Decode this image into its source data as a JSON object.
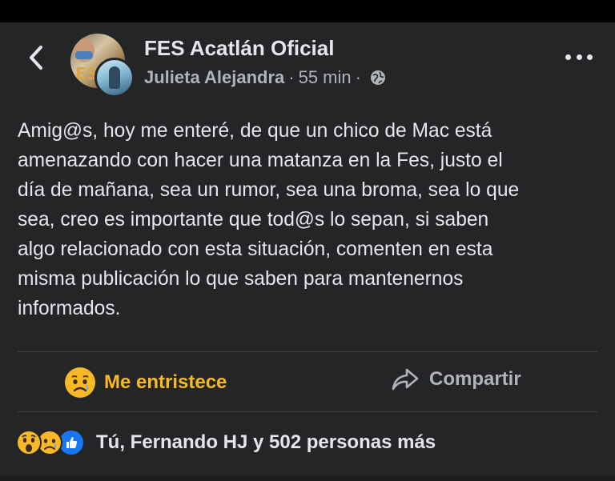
{
  "post": {
    "page_name": "FES Acatlán Oficial",
    "author": "Julieta Alejandra",
    "separator": "·",
    "time": "55 min",
    "separator2": "·",
    "privacy_icon": "globe-icon",
    "text": "Amig@s, hoy me enteré, de que un chico de Mac está\namenazando con hacer una matanza en la Fes, justo el\ndía de mañana, sea un rumor, sea una broma, sea lo que\nsea, creo es importante que tod@s lo sepan, si saben\nalgo relacionado con esta situación, comenten en esta\nmisma publicación lo que saben para mantenernos\ninformados."
  },
  "actions": {
    "reaction_label": "Me entristece",
    "reaction_icon": "sad-emoji-icon",
    "share_label": "Compartir",
    "share_icon": "share-icon"
  },
  "reactions": {
    "icons": [
      "wow-emoji-icon",
      "sad-emoji-icon",
      "like-icon"
    ],
    "summary": "Tú, Fernando HJ y 502 personas más"
  },
  "colors": {
    "background": "#242526",
    "text": "#e4e6eb",
    "secondary_text": "#b0b3b8",
    "reaction_yellow": "#f7b928",
    "like_blue": "#1877f2"
  }
}
